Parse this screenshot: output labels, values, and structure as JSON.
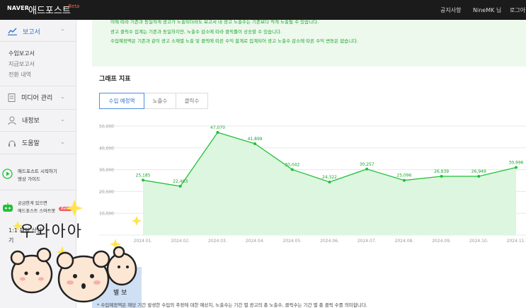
{
  "topbar": {
    "logo": "NAVER",
    "app_name": "애드포스트",
    "beta": "Beta",
    "notice_link": "공지사항",
    "user": "NineMK 님",
    "logout": "로그아"
  },
  "sidebar": {
    "report": {
      "label": "보고서",
      "items": [
        "수입보고서",
        "지급보고서",
        "전환 내역"
      ]
    },
    "media": {
      "label": "미디어 관리"
    },
    "myinfo": {
      "label": "내정보"
    },
    "help": {
      "label": "도움말"
    },
    "guide": {
      "line1": "애드포스트 시작하기",
      "line2": "영상 가이드"
    },
    "smartbot": {
      "line1": "궁금한게 있으면",
      "line2": "애드포스트 스마트봇",
      "badge": "Beta"
    },
    "chat": {
      "label": "1:1 채팅 상담",
      "line2": "기"
    }
  },
  "notice": {
    "line1": "이에 따라 기존과 동일하게 광고가 노출되더라도 보고서 내 광고 노출수는 기존보다 적게 노출될 수 있습니다.",
    "line2": "광고 클릭수 집계는 기존과 동일하지만, 노출수 감소에 따라 클릭률이 상승할 수 있습니다.",
    "line3": "수입예정액은 기존과 같이 광고 소재별 노출 및 클릭에 따른 수익 합계로 집계되어 광고 노출수 감소에 따른 수익 변동은 없습니다."
  },
  "graph": {
    "title": "그래프 지표",
    "tabs": [
      "수입 예정액",
      "노출수",
      "클릭수"
    ]
  },
  "chart_data": {
    "type": "area",
    "x": [
      "2024.01.",
      "2024.02.",
      "2024.03.",
      "2024.04.",
      "2024.05.",
      "2024.06.",
      "2024.07.",
      "2024.08.",
      "2024.09.",
      "2024.10.",
      "2024.11."
    ],
    "values": [
      25185,
      22403,
      47070,
      41899,
      30042,
      24322,
      30257,
      25096,
      26939,
      26949,
      30996
    ],
    "value_labels": [
      "25,185",
      "22,403",
      "47,070",
      "41,899",
      "30,042",
      "24,322",
      "30,257",
      "25,096",
      "26,939",
      "26,949",
      "30,996"
    ],
    "y_ticks": [
      "50,000",
      "40,000",
      "30,000",
      "20,000",
      "10,000",
      "0"
    ],
    "ylim": [
      0,
      50000
    ],
    "grid": true,
    "colors": {
      "line": "#22c03a",
      "fill": "#ddf6df",
      "label": "#1aa62b"
    }
  },
  "overlay": {
    "text": "우와아아",
    "partial_text": "별 보"
  },
  "footnote": "* 수입예정액은 해당 기간 발생한 수입의 추정에 대한 예상치, 노출수는 기간 별 광고의 총 노출수, 클릭수는 기간 별 총 클릭 수를 의미합니다."
}
